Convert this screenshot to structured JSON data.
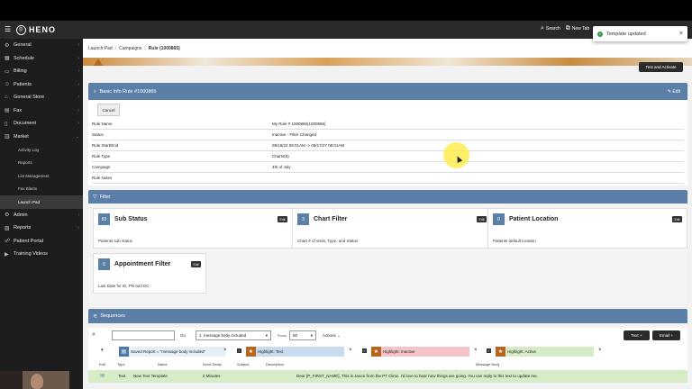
{
  "app": {
    "name": "HENO"
  },
  "topbar": {
    "search_label": "Search",
    "new_tab_label": "New Tab"
  },
  "toast": {
    "message": "Template updated"
  },
  "sidebar": {
    "items": [
      {
        "label": "General",
        "icon": "gear-icon"
      },
      {
        "label": "Schedule",
        "icon": "calendar-icon"
      },
      {
        "label": "Billing",
        "icon": "billing-icon"
      },
      {
        "label": "Patients",
        "icon": "patients-icon"
      },
      {
        "label": "General Store",
        "icon": "store-icon"
      },
      {
        "label": "Fax",
        "icon": "fax-icon"
      },
      {
        "label": "Document",
        "icon": "document-icon"
      },
      {
        "label": "Market",
        "icon": "market-icon"
      }
    ],
    "market_subitems": [
      "Activity Log",
      "Reports",
      "List Management",
      "Fax Blasts",
      "Launch Pad"
    ],
    "bottom_items": [
      {
        "label": "Admin",
        "icon": "admin-icon"
      },
      {
        "label": "Reports",
        "icon": "reports-icon"
      },
      {
        "label": "Patient Portal",
        "icon": "portal-icon"
      },
      {
        "label": "Training Videos",
        "icon": "video-icon"
      }
    ]
  },
  "breadcrumb": {
    "items": [
      "Launch Pad",
      "Campaigns",
      "Rule (1000865)"
    ]
  },
  "actions": {
    "test_activate": "Test and Activate"
  },
  "basic_info": {
    "title": "Basic Info Rule #1000865",
    "edit_label": "Edit",
    "cancel_label": "Cancel",
    "rows": [
      {
        "label": "Rule Name",
        "value": "My Rule # 1000865(1000865)"
      },
      {
        "label": "Status",
        "value": "Inactive - Filter Changed"
      },
      {
        "label": "Rule Start/End",
        "value": "09/18/22 08:01AM -> 09/17/27 08:01AM"
      },
      {
        "label": "Rule Type",
        "value": "Charts(5)"
      },
      {
        "label": "Campaign",
        "value": "4th of July"
      },
      {
        "label": "Rule Notes",
        "value": ""
      }
    ]
  },
  "filter": {
    "title": "Filter",
    "cards": [
      {
        "num": "83",
        "title": "Sub Status",
        "desc": "Patients sub status",
        "edit": "Edit"
      },
      {
        "num": "3",
        "title": "Chart Filter",
        "desc": "Chart # of visits, Type, and Status",
        "edit": "Edit"
      },
      {
        "num": "0",
        "title": "Patient Location",
        "desc": "Patients default location",
        "edit": "Edit"
      },
      {
        "num": "0",
        "title": "Appointment Filter",
        "desc": "Last Date for IE, PN and DC",
        "edit": "Edit"
      }
    ]
  },
  "sequences": {
    "title": "Sequences",
    "go_label": "Go",
    "report_select": "1. message body included",
    "rows_label": "Rows",
    "rows_value": "50",
    "actions_label": "Actions",
    "text_button": "Text",
    "email_button": "Email",
    "saved_report": "Saved Report = \"message body included\"",
    "highlights": [
      {
        "label": "Highlight: Text",
        "color": "#c9dcef"
      },
      {
        "label": "Highlight: Inactive",
        "color": "#f3c3c8"
      },
      {
        "label": "Highlight: Active",
        "color": "#d6ecc6"
      }
    ],
    "columns": [
      "Edit",
      "Type",
      "Name",
      "Send Delay",
      "Subject",
      "Description",
      "Message Body"
    ],
    "rows": [
      {
        "type": "Text",
        "name": "New Text Template",
        "send_delay": "0 Minutes",
        "subject": "",
        "description": "",
        "message_body": "Dear [P_FIRST_NAME], This is Jason from the PT Clinic. I'd love to hear how things are going. You can reply to this text to update me."
      }
    ]
  }
}
